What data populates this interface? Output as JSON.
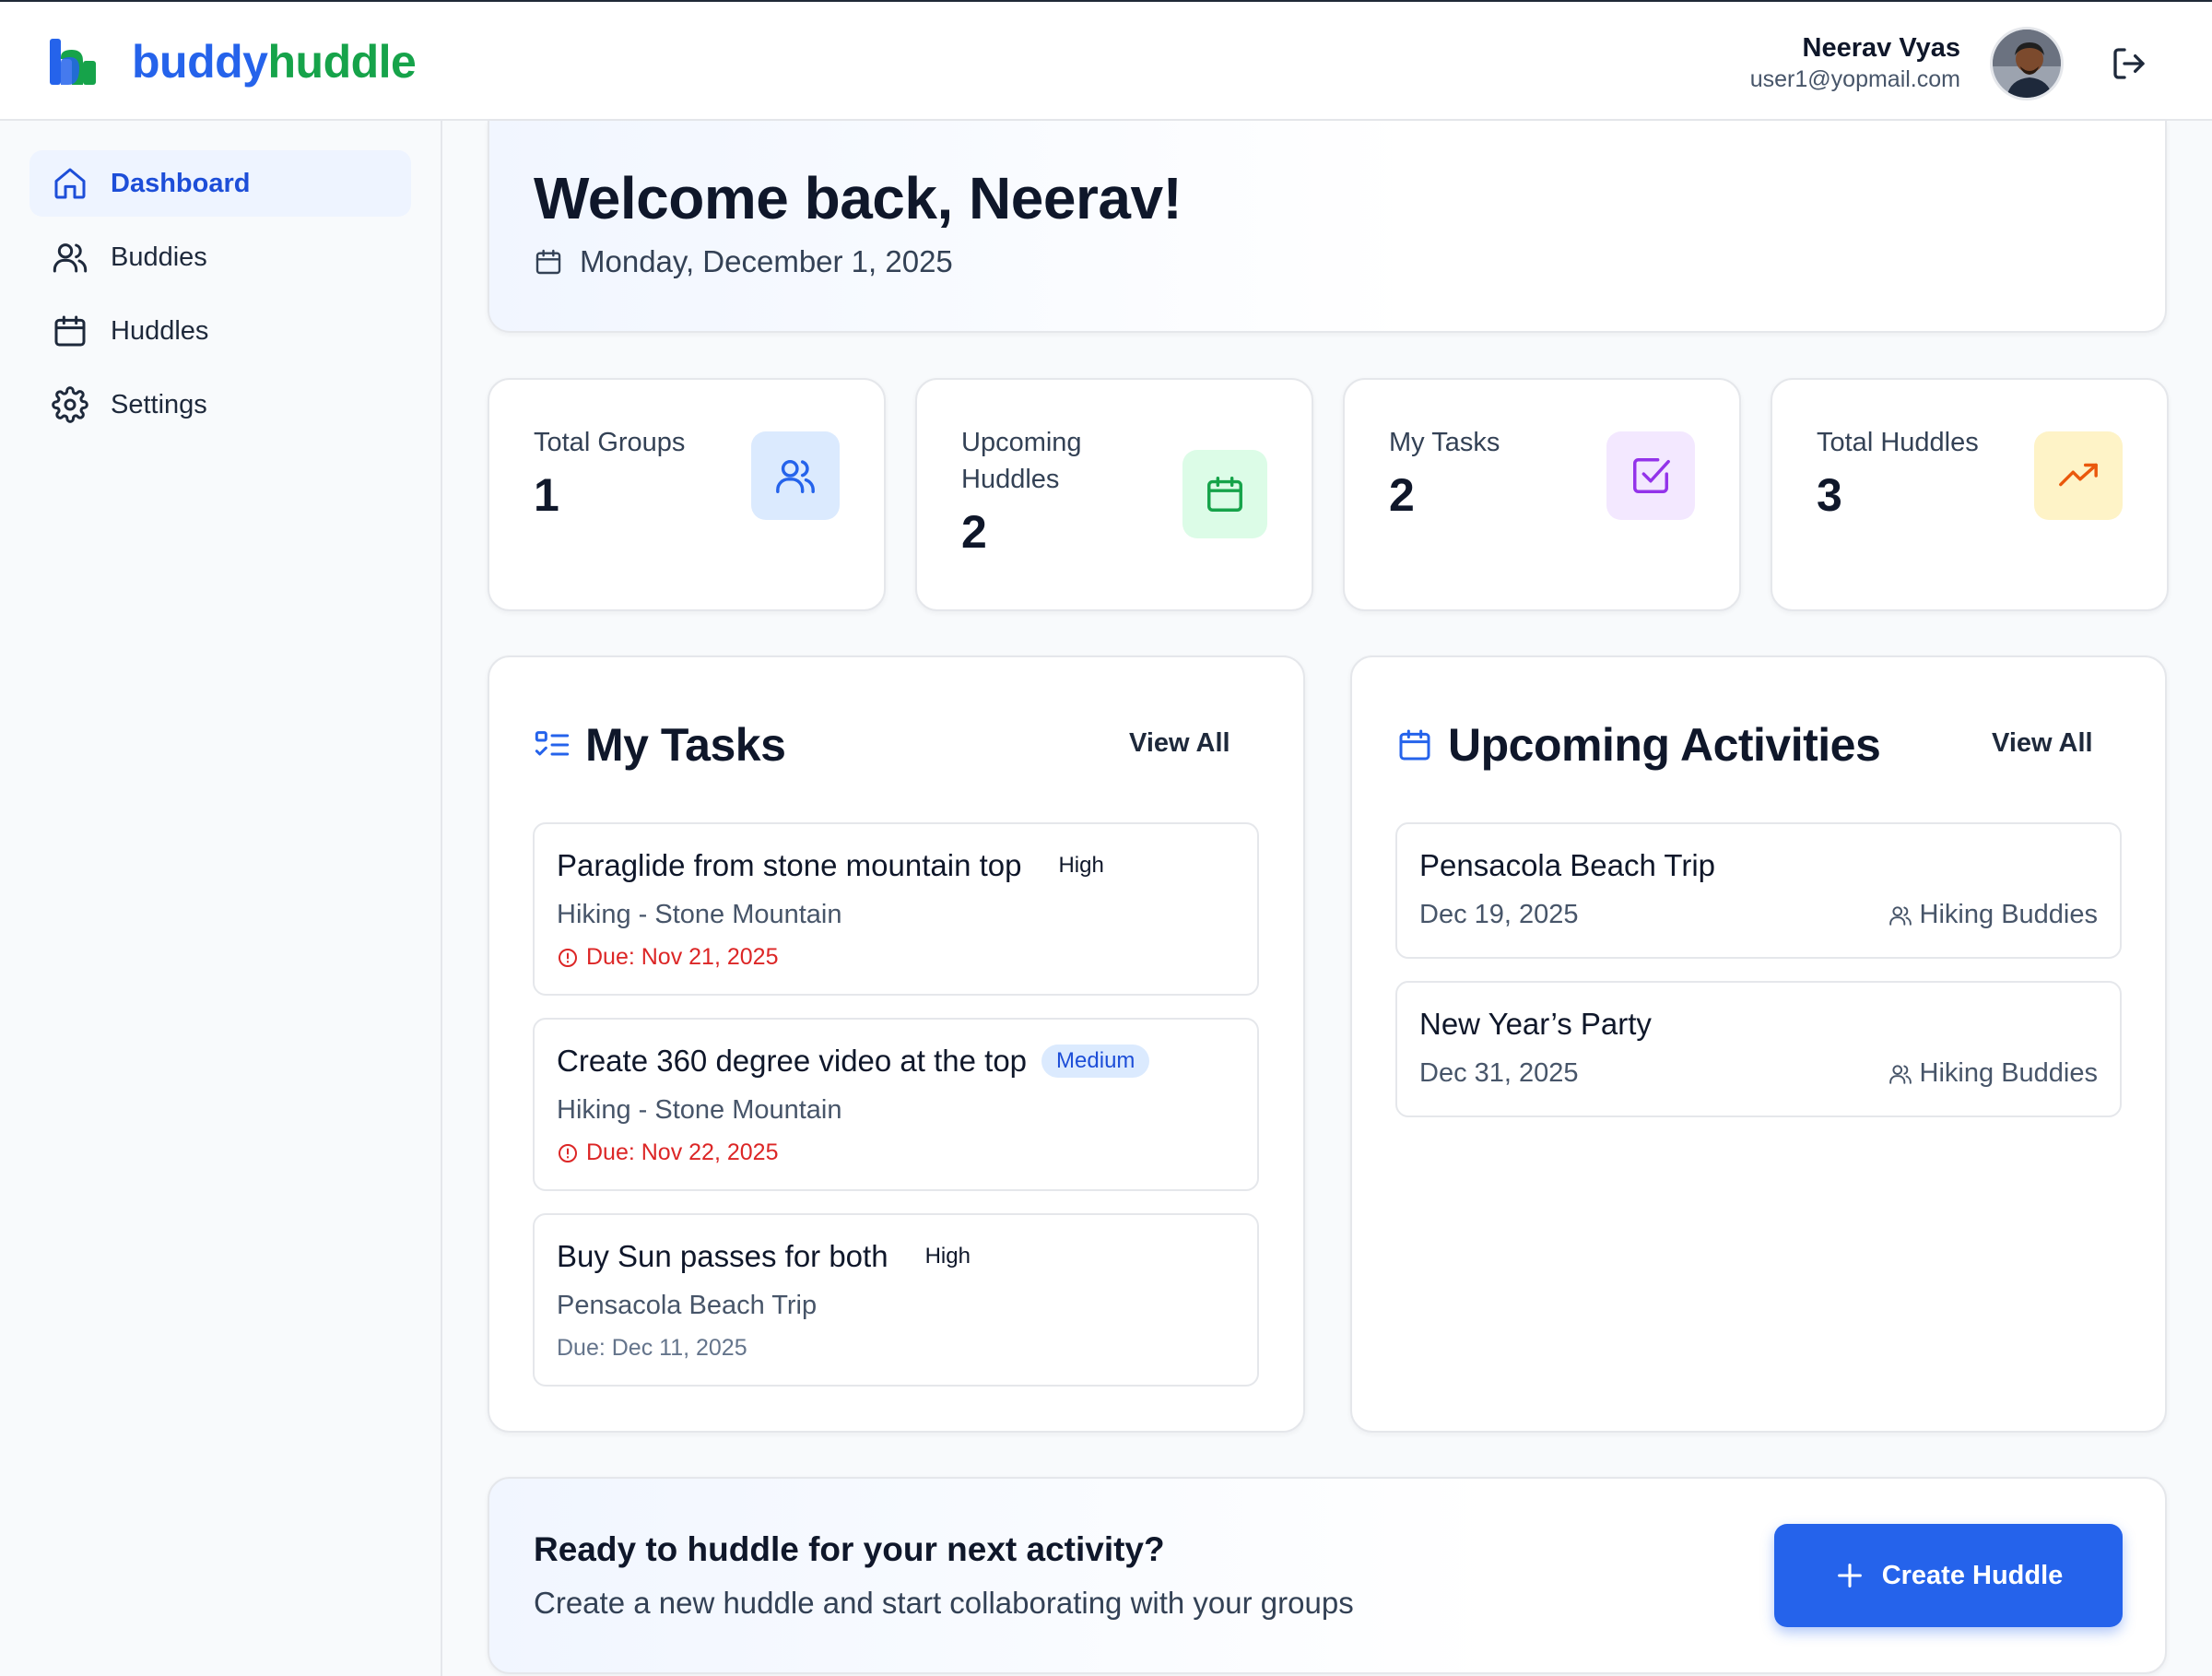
{
  "brand": {
    "name_part1": "buddy",
    "name_part2": "huddle",
    "mark": "bh"
  },
  "user": {
    "name": "Neerav Vyas",
    "email": "user1@yopmail.com"
  },
  "sidebar": {
    "items": [
      {
        "label": "Dashboard",
        "icon": "home-icon",
        "active": true
      },
      {
        "label": "Buddies",
        "icon": "users-icon"
      },
      {
        "label": "Huddles",
        "icon": "calendar-icon"
      },
      {
        "label": "Settings",
        "icon": "gear-icon"
      }
    ]
  },
  "welcome": {
    "title": "Welcome back, Neerav!",
    "date": "Monday, December 1, 2025"
  },
  "stats": [
    {
      "label": "Total Groups",
      "value": "1",
      "icon": "users-icon",
      "color": "#2563eb",
      "bg": "#dbeafe"
    },
    {
      "label": "Upcoming Huddles",
      "value": "2",
      "icon": "calendar-icon",
      "color": "#16a34a",
      "bg": "#dcfce7"
    },
    {
      "label": "My Tasks",
      "value": "2",
      "icon": "check-square-icon",
      "color": "#9333ea",
      "bg": "#f3e8ff"
    },
    {
      "label": "Total Huddles",
      "value": "3",
      "icon": "trending-up-icon",
      "color": "#ea580c",
      "bg": "#fef3c7"
    }
  ],
  "tasks": {
    "title": "My Tasks",
    "view_all": "View All",
    "items": [
      {
        "title": "Paraglide from stone mountain top",
        "priority": "High",
        "group": "Hiking - Stone Mountain",
        "due": "Due: Nov 21, 2025",
        "overdue": true
      },
      {
        "title": "Create 360 degree video at the top",
        "priority": "Medium",
        "group": "Hiking - Stone Mountain",
        "due": "Due: Nov 22, 2025",
        "overdue": true
      },
      {
        "title": "Buy Sun passes for both",
        "priority": "High",
        "group": "Pensacola Beach Trip",
        "due": "Due: Dec 11, 2025",
        "overdue": false
      }
    ]
  },
  "activities": {
    "title": "Upcoming Activities",
    "view_all": "View All",
    "items": [
      {
        "title": "Pensacola Beach Trip",
        "date": "Dec 19, 2025",
        "group": "Hiking Buddies"
      },
      {
        "title": "New Year’s Party",
        "date": "Dec 31, 2025",
        "group": "Hiking Buddies"
      }
    ]
  },
  "cta": {
    "title": "Ready to huddle for your next activity?",
    "subtitle": "Create a new huddle and start collaborating with your groups",
    "button": "Create Huddle"
  },
  "colors": {
    "accent": "#2563eb",
    "brand_green": "#16a34a",
    "danger": "#dc2626"
  }
}
